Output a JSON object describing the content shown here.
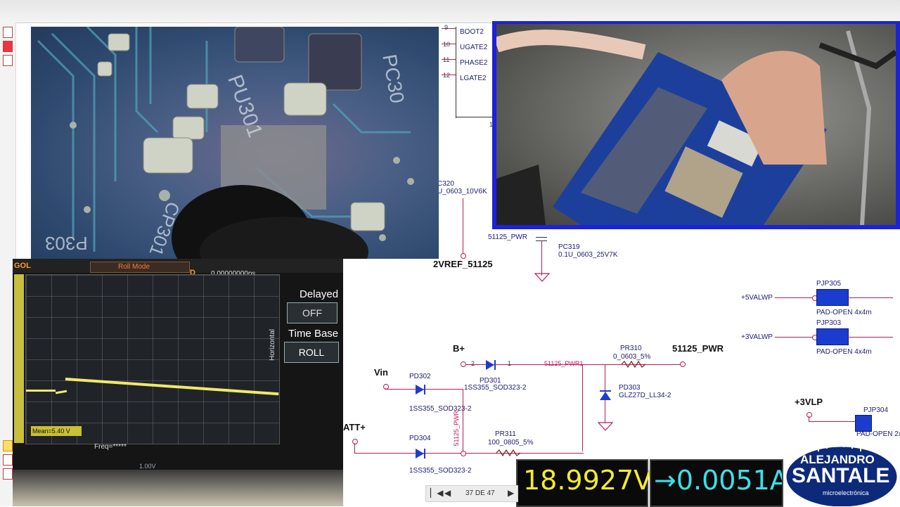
{
  "viewer": {
    "page_indicator": "37 DE 47",
    "nav_first": "▏◀",
    "nav_prev": "◀",
    "nav_next": "▶"
  },
  "schematic": {
    "pins": [
      {
        "num": "9",
        "label": "BOOT2"
      },
      {
        "num": "10",
        "label": "UGATE2"
      },
      {
        "num": "11",
        "label": "PHASE2"
      },
      {
        "num": "12",
        "label": "LGATE2"
      }
    ],
    "pin_13": "13",
    "pc320_ref": "C320",
    "pc320_val": "U_0603_10V6K",
    "net_51125_pwr_small": "51125_PWR",
    "pc319_ref": "PC319",
    "pc319_val": "0.1U_0603_25V7K",
    "vref": "2VREF_51125",
    "rail_5valwp": "+5VALWP",
    "rail_3valwp": "+3VALWP",
    "pjp305_ref": "PJP305",
    "pjp305_val": "PAD-OPEN 4x4m",
    "pjp303_ref": "PJP303",
    "pjp303_val": "PAD-OPEN 4x4m",
    "bplus": "B+",
    "pd301_ref": "PD301",
    "pd301_val": "1SS355_SOD323-2",
    "net_pwr_b1": "51125_PWR1",
    "pr310_ref": "PR310",
    "pr310_val": "0_0603_5%",
    "net_51125_pwr": "51125_PWR",
    "pd303_ref": "PD303",
    "pd303_val": "GLZ27D_LL34-2",
    "vin": "Vin",
    "pd302_ref": "PD302",
    "pd302_val": "1SS355_SOD323-2",
    "att": "ATT+",
    "pd304_ref": "PD304",
    "pd304_val": "1SS355_SOD323-2",
    "pr311_ref": "PR311",
    "pr311_val": "100_0805_5%",
    "net_vertical": "51125_PWR",
    "rail_3vlp": "+3VLP",
    "pjp304_ref": "PJP304",
    "pjp304_val": "PAD-OPEN 2x",
    "pin1": "1",
    "pin2": "2"
  },
  "pcb_photo": {
    "silk_1": "PU301",
    "silk_2": "PC30",
    "silk_3": "CP301",
    "silk_4": "P303"
  },
  "scope": {
    "top_left": "GOL",
    "mode": "Roll Mode",
    "delay_label": "D",
    "delay_value": "0.00000000ps",
    "side_label": "Horizontal",
    "delayed_title": "Delayed",
    "delayed_value": "OFF",
    "timebase_title": "Time Base",
    "timebase_value": "ROLL",
    "measure": "Mean=5.40 V",
    "freq": "Freq=*****",
    "ch_scale": "1.00V"
  },
  "meters": {
    "voltage": "18.9927V",
    "current": "→0.0051A",
    "voltage_color": "#f2ec2a",
    "current_color": "#3be0e6"
  },
  "logo": {
    "line1": "ALEJANDRO",
    "line2": "SANTALE",
    "line3": "microelectrónica"
  }
}
